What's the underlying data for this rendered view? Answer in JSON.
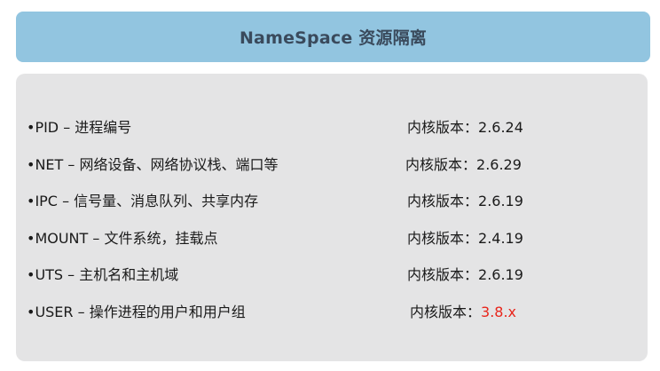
{
  "header": {
    "title": "NameSpace 资源隔离"
  },
  "rows": [
    {
      "label": "•PID – 进程编号",
      "version_label": "内核版本：",
      "version": "2.6.24"
    },
    {
      "label": "•NET – 网络设备、网络协议栈、端口等",
      "version_label": "内核版本：",
      "version": "2.6.29"
    },
    {
      "label": "•IPC – 信号量、消息队列、共享内存",
      "version_label": "内核版本：",
      "version": "2.6.19"
    },
    {
      "label": "•MOUNT – 文件系统，挂载点",
      "version_label": "内核版本：",
      "version": "2.4.19"
    },
    {
      "label": "•UTS – 主机名和主机域",
      "version_label": "内核版本：",
      "version": "2.6.19"
    },
    {
      "label": "•USER – 操作进程的用户和用户组",
      "version_label": "内核版本：",
      "version": "3.8.x"
    }
  ],
  "colors": {
    "header_bg": "#92c5e0",
    "panel_bg": "#e4e4e5",
    "highlight": "#e8251b"
  }
}
